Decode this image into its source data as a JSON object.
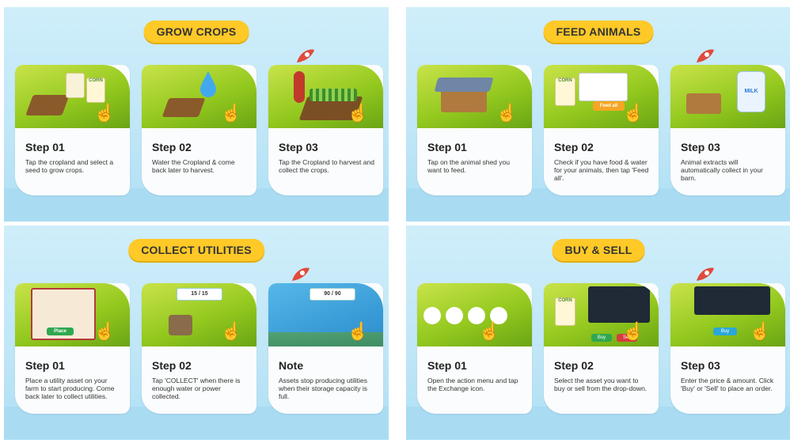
{
  "panels": [
    {
      "title": "GROW CROPS",
      "cards": [
        {
          "step": "Step 01",
          "desc": "Tap the cropland and select a seed to grow crops."
        },
        {
          "step": "Step 02",
          "desc": "Water the Cropland & come back later to harvest."
        },
        {
          "step": "Step 03",
          "desc": "Tap the Cropland to harvest and collect the crops."
        }
      ]
    },
    {
      "title": "FEED ANIMALS",
      "cards": [
        {
          "step": "Step 01",
          "desc": "Tap on the animal shed you want to feed."
        },
        {
          "step": "Step 02",
          "desc": "Check if you have food & water for your animals, then tap 'Feed all'."
        },
        {
          "step": "Step 03",
          "desc": "Animal extracts will automatically collect in your barn."
        }
      ]
    },
    {
      "title": "COLLECT UTILITIES",
      "cards": [
        {
          "step": "Step 01",
          "desc": "Place a utility asset on your farm to start producing. Come back later to collect utilities."
        },
        {
          "step": "Step 02",
          "desc": "Tap 'COLLECT' when there is enough water or power collected."
        },
        {
          "step": "Note",
          "desc": "Assets stop producing utilities when their storage capacity is full."
        }
      ]
    },
    {
      "title": "BUY & SELL",
      "cards": [
        {
          "step": "Step 01",
          "desc": "Open the action menu and tap the Exchange icon."
        },
        {
          "step": "Step 02",
          "desc": "Select the asset you want to buy or sell from the drop-down."
        },
        {
          "step": "Step 03",
          "desc": "Enter the price & amount. Click 'Buy' or 'Sell' to place an order."
        }
      ]
    }
  ],
  "scene_text": {
    "corn": "CORN",
    "milk": "MILK",
    "feed_all": "Feed all",
    "utility_count_1": "15 / 15",
    "utility_count_2": "90 / 90",
    "place": "Place",
    "buy": "Buy",
    "sell": "Sell"
  },
  "colors": {
    "pill": "#ffc927",
    "panel_bg": "#cfeefa",
    "card_bg": "#fbfcfd",
    "scene_green": "#94c91f"
  }
}
